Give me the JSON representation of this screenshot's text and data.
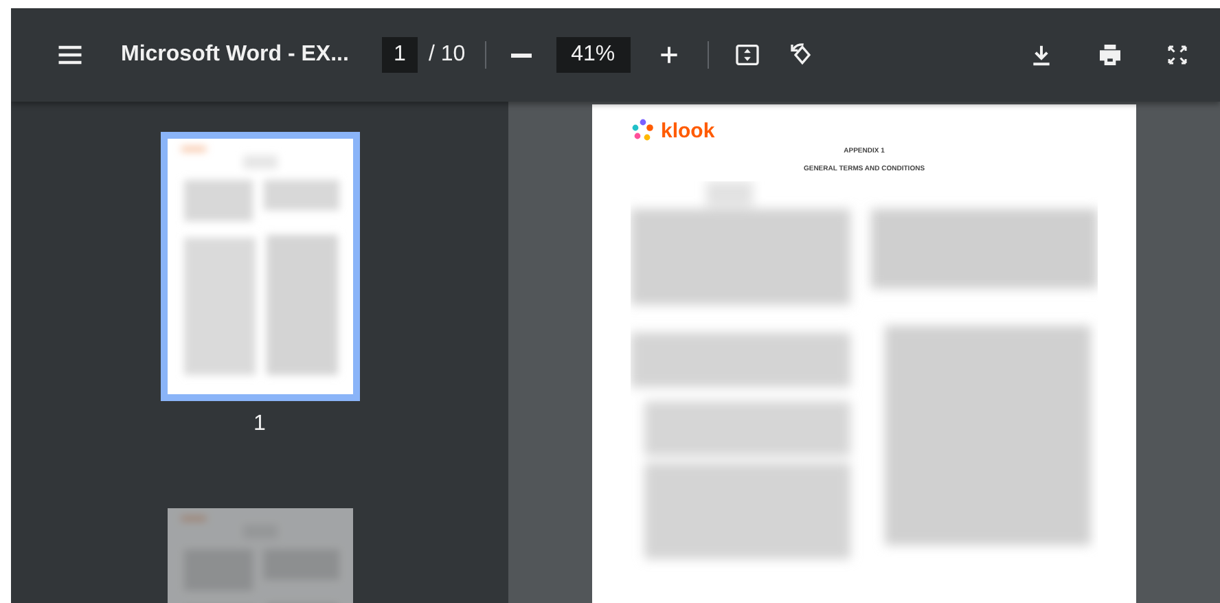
{
  "toolbar": {
    "title": "Microsoft Word - EX...",
    "page_number": "1",
    "page_total": "/ 10",
    "zoom": "41%"
  },
  "thumbnails": [
    {
      "label": "1",
      "selected": true
    },
    {
      "selected": false
    }
  ],
  "document": {
    "logo": "klook",
    "headings": [
      "APPENDIX 1",
      "GENERAL TERMS AND CONDITIONS"
    ]
  }
}
